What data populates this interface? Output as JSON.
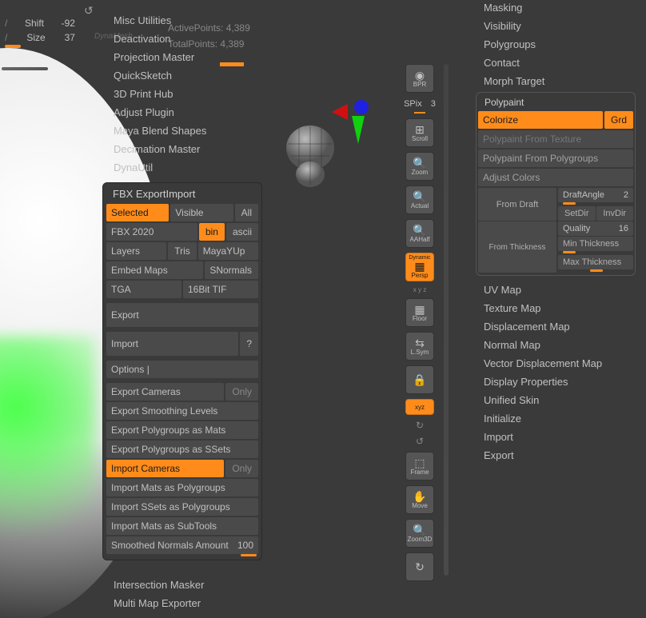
{
  "left": {
    "shift_label": "Shift",
    "shift_val": "-92",
    "size_label": "Size",
    "size_val": "37"
  },
  "info": {
    "active_label": "ActivePoints:",
    "active_val": "4,389",
    "total_label": "TotalPoints:",
    "total_val": "4,389"
  },
  "plugins": [
    "Misc Utilities",
    "Deactivation",
    "Projection Master",
    "QuickSketch",
    "3D Print Hub",
    "Adjust Plugin",
    "Maya Blend Shapes",
    "Decimation Master",
    "DynaUtil"
  ],
  "plugins_after": [
    "Intersection Masker",
    "Multi Map Exporter"
  ],
  "fbx": {
    "title": "FBX ExportImport",
    "sel": "Selected",
    "vis": "Visible",
    "all": "All",
    "ver": "FBX 2020",
    "bin": "bin",
    "ascii": "ascii",
    "layers": "Layers",
    "tris": "Tris",
    "maya": "MayaYUp",
    "embed": "Embed Maps",
    "snorm": "SNormals",
    "tga": "TGA",
    "tif": "16Bit TIF",
    "export": "Export",
    "import": "Import",
    "q": "?",
    "options": "Options  |",
    "exp_cam": "Export Cameras",
    "only": "Only",
    "exp_sm": "Export Smoothing Levels",
    "exp_pg_m": "Export Polygroups as Mats",
    "exp_pg_s": "Export Polygroups as SSets",
    "imp_cam": "Import Cameras",
    "imp_m_pg": "Import Mats as Polygroups",
    "imp_s_pg": "Import SSets as Polygroups",
    "imp_m_st": "Import Mats as SubTools",
    "smn": "Smoothed Normals Amount",
    "smn_v": "100"
  },
  "toolbar": {
    "bpr": "BPR",
    "spix": "SPix",
    "spix_v": "3",
    "scroll": "Scroll",
    "zoom": "Zoom",
    "actual": "Actual",
    "aahalf": "AAHalf",
    "persp": "Persp",
    "dynamic": "Dynamic",
    "floor": "Floor",
    "lsym": "L.Sym",
    "xyz": "xyz",
    "frame": "Frame",
    "move": "Move",
    "zoom3d": "Zoom3D"
  },
  "right_menu_top": [
    "Masking",
    "Visibility",
    "Polygroups",
    "Contact",
    "Morph Target"
  ],
  "polypaint": {
    "title": "Polypaint",
    "colorize": "Colorize",
    "grd": "Grd",
    "from_tex": "Polypaint From Texture",
    "from_pg": "Polypaint From Polygroups",
    "adjust": "Adjust Colors",
    "from_draft": "From Draft",
    "draft_angle": "DraftAngle",
    "draft_angle_v": "2",
    "setdir": "SetDir",
    "invdir": "InvDir",
    "from_thick": "From Thickness",
    "quality": "Quality",
    "quality_v": "16",
    "min_t": "Min Thickness",
    "max_t": "Max Thickness"
  },
  "right_menu_bottom": [
    "UV Map",
    "Texture Map",
    "Displacement Map",
    "Normal Map",
    "Vector Displacement Map",
    "Display Properties",
    "Unified Skin",
    "Initialize",
    "Import",
    "Export"
  ],
  "dyna": "DynaMesh"
}
